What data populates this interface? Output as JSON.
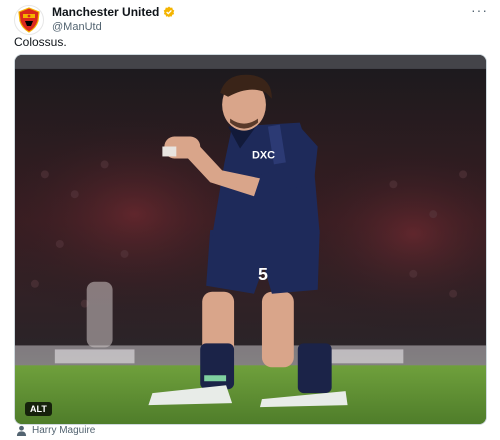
{
  "author": {
    "display_name": "Manchester United",
    "handle": "@ManUtd",
    "avatar_icon": "manchester-united-crest-icon",
    "verified_icon": "verified-badge-icon",
    "verified_color": "#f4b400"
  },
  "menu": {
    "icon": "more-options-icon",
    "label": "···"
  },
  "tweet": {
    "text": "Colossus."
  },
  "media": {
    "type": "photo",
    "jersey_number": "5",
    "sponsor_text": "DXC",
    "alt_label": "ALT"
  },
  "tag": {
    "icon": "person-icon",
    "name": "Harry Maguire"
  },
  "colors": {
    "text_primary": "#0f1419",
    "text_secondary": "#536471",
    "kit_navy": "#1e2a5a",
    "pitch_green": "#6b9a3a"
  }
}
